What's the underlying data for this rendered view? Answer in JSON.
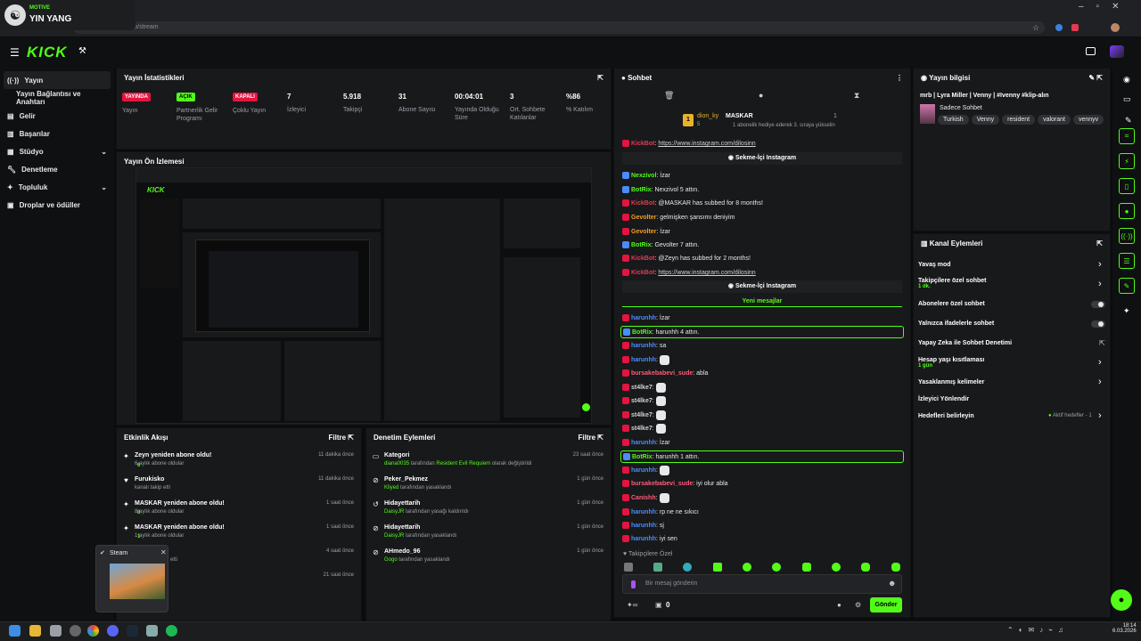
{
  "browser": {
    "url": "dashboard.kick.com/stream",
    "tab_plus": "+"
  },
  "media": {
    "app": "MOTIVE",
    "title": "YIN YANG"
  },
  "header": {
    "logo": "KICK"
  },
  "sidebar": {
    "items": [
      {
        "label": "Yayın",
        "icon": "broadcast-icon"
      },
      {
        "label": "Yayın Bağlantısı ve Anahtarı",
        "icon": ""
      },
      {
        "label": "Gelir",
        "icon": "revenue-icon"
      },
      {
        "label": "Başarılar",
        "icon": "trophy-icon"
      },
      {
        "label": "Stüdyo",
        "icon": "studio-icon"
      },
      {
        "label": "Denetleme",
        "icon": "wrench-icon"
      },
      {
        "label": "Topluluk",
        "icon": "community-icon"
      },
      {
        "label": "Droplar ve ödüller",
        "icon": "gift-icon"
      }
    ]
  },
  "stats": {
    "title": "Yayın İstatistikleri",
    "items": [
      {
        "badge": "YAYINDA",
        "label": "Yayın"
      },
      {
        "badge": "AÇIK",
        "label": "Partnerlik Gelir Programı"
      },
      {
        "badge": "KAPALI",
        "label": "Çoklu Yayın"
      },
      {
        "value": "7",
        "label": "İzleyici"
      },
      {
        "value": "5.918",
        "label": "Takipçi"
      },
      {
        "value": "31",
        "label": "Abone Sayısı"
      },
      {
        "value": "00:04:01",
        "label": "Yayında Olduğu Süre"
      },
      {
        "value": "3",
        "label": "Ort. Sohbete Katılanlar"
      },
      {
        "value": "%86",
        "label": "% Katılım"
      }
    ]
  },
  "preview": {
    "title": "Yayın Ön İzlemesi"
  },
  "activity": {
    "title": "Etkinlik Akışı",
    "filter": "Filtre",
    "rows": [
      {
        "t1": "Zeyn yeniden abone oldu!",
        "t2": "6 aylık abone oldular",
        "time": "11 dakika önce"
      },
      {
        "t1": "Furukisko",
        "t2": "kanalı takip etti",
        "time": "11 dakika önce"
      },
      {
        "t1": "MASKAR yeniden abone oldu!",
        "t2": "8 aylık abone oldular",
        "time": "1 saat önce"
      },
      {
        "t1": "MASKAR yeniden abone oldu!",
        "t2": "1 aylık abone oldular",
        "time": "1 saat önce"
      },
      {
        "t1": "",
        "t2": "etti",
        "time": "4 saat önce"
      },
      {
        "t1": "",
        "t2": "",
        "time": "21 saat önce"
      }
    ]
  },
  "moderation": {
    "title": "Denetim Eylemleri",
    "filter": "Filtre",
    "rows": [
      {
        "t1": "Kategori",
        "user": "diana0035",
        "mid": " tarafından ",
        "hl": "Resident Evil Requiem",
        "end": " olarak değiştirildi",
        "time": "23 saat önce"
      },
      {
        "t1": "Peker_Pekmez",
        "user": "Kliyed",
        "mid": " tarafından yasaklandı",
        "hl": "",
        "end": "",
        "time": "1 gün önce"
      },
      {
        "t1": "Hidayettarih",
        "user": "DaisyJR",
        "mid": " tarafından yasağı kaldırıldı",
        "hl": "",
        "end": "",
        "time": "1 gün önce"
      },
      {
        "t1": "Hidayettarih",
        "user": "DaisyJR",
        "mid": " tarafından yasaklandı",
        "hl": "",
        "end": "",
        "time": "1 gün önce"
      },
      {
        "t1": "AHmedo_96",
        "user": "Gogo",
        "mid": " tarafından yasaklandı",
        "hl": "",
        "end": "",
        "time": "1 gün önce"
      }
    ]
  },
  "steam_popup": {
    "title": "Steam"
  },
  "chat": {
    "title": "Sohbet",
    "pinned_user": "dion_ky",
    "pinned_count": "5",
    "pinned_name": "MASKAR",
    "pinned_num": "1",
    "pinned_note": "1 abonelik hediye ederek 3. sıraya yükselin",
    "lines": [
      {
        "user": "KickBot",
        "ucolor": "#e23b52",
        "text": "https://www.instagram.com/dilosinn",
        "link": true
      },
      {
        "center": "Sekme-İçi Instagram"
      },
      {
        "user": "Nexzivol",
        "ucolor": "#53fc18",
        "text": "İzar"
      },
      {
        "user": "BotRix",
        "ucolor": "#53fc18",
        "text": "Nexzivol 5 attın."
      },
      {
        "user": "KickBot",
        "ucolor": "#e23b52",
        "text": "@MASKAR has subbed for 8 months!"
      },
      {
        "user": "Gevolter",
        "ucolor": "#f0a020",
        "text": "gelmişken şansımı deniyim"
      },
      {
        "user": "Gevolter",
        "ucolor": "#f0a020",
        "text": "İzar"
      },
      {
        "user": "BotRix",
        "ucolor": "#53fc18",
        "text": "Gevolter 7 attın."
      },
      {
        "user": "KickBot",
        "ucolor": "#e23b52",
        "text": "@Zeyn has subbed for 2 months!"
      },
      {
        "user": "KickBot",
        "ucolor": "#e23b52",
        "text": "https://www.instagram.com/dilosinn",
        "link": true
      },
      {
        "center": "Sekme-İçi Instagram"
      },
      {
        "divider": "Yeni mesajlar"
      },
      {
        "user": "harunhh",
        "ucolor": "#4a8cff",
        "text": "İzar"
      },
      {
        "user": "BotRix",
        "ucolor": "#53fc18",
        "text": "harunhh 4 attın.",
        "box": true
      },
      {
        "user": "harunhh",
        "ucolor": "#4a8cff",
        "text": "sa"
      },
      {
        "user": "harunhh",
        "ucolor": "#4a8cff",
        "text": "",
        "emote": true
      },
      {
        "user": "bursakebabevi_sude",
        "ucolor": "#ff5a7a",
        "text": "abla"
      },
      {
        "user": "st4lke7",
        "ucolor": "#cfd3d7",
        "text": "",
        "emote": true
      },
      {
        "user": "st4lke7",
        "ucolor": "#cfd3d7",
        "text": "",
        "emote": true
      },
      {
        "user": "st4lke7",
        "ucolor": "#cfd3d7",
        "text": "",
        "emote": true
      },
      {
        "user": "st4lke7",
        "ucolor": "#cfd3d7",
        "text": "",
        "emote": true
      },
      {
        "user": "harunhh",
        "ucolor": "#4a8cff",
        "text": "İzar"
      },
      {
        "user": "BotRix",
        "ucolor": "#53fc18",
        "text": "harunhh 1 attın.",
        "box": true
      },
      {
        "user": "harunhh",
        "ucolor": "#4a8cff",
        "text": "",
        "emote": true
      },
      {
        "user": "bursakebabevi_sude",
        "ucolor": "#ff5a7a",
        "text": "iyi olur abla"
      },
      {
        "user": "Canishh",
        "ucolor": "#ff5a7a",
        "text": "",
        "emote": true
      },
      {
        "user": "harunhh",
        "ucolor": "#4a8cff",
        "text": "rp ne ne sıkıcı"
      },
      {
        "user": "harunhh",
        "ucolor": "#4a8cff",
        "text": "sj"
      },
      {
        "user": "harunhh",
        "ucolor": "#4a8cff",
        "text": "iyi sen"
      }
    ],
    "followers_only": "Takipçilere Özel",
    "input_placeholder": "Bir mesaj gönderin",
    "send": "Gönder",
    "footer_count": "0"
  },
  "stream_info": {
    "title": "Yayın bilgisi",
    "stream_title": "mrb | Lyra Miller | Venny | #Ivenny #klip-alın",
    "mode": "Sadece Sohbet",
    "tags": [
      "Turkish",
      "Venny",
      "resident",
      "valorant",
      "vennyv"
    ]
  },
  "channel_actions": {
    "title": "Kanal Eylemleri",
    "rows": [
      {
        "label": "Yavaş mod",
        "sub": "",
        "kind": "arrow"
      },
      {
        "label": "Takipçilere özel sohbet",
        "sub": "1 dk.",
        "kind": "arrow"
      },
      {
        "label": "Abonelere özel sohbet",
        "sub": "",
        "kind": "toggle"
      },
      {
        "label": "Yalnızca ifadelerle sohbet",
        "sub": "",
        "kind": "toggle"
      },
      {
        "label": "Yapay Zeka ile Sohbet Denetimi",
        "sub": "",
        "kind": "ext"
      },
      {
        "label": "Hesap yaşı kısıtlaması",
        "sub": "1 gün",
        "kind": "arrow"
      },
      {
        "label": "Yasaklanmış kelimeler",
        "sub": "",
        "kind": "arrow"
      },
      {
        "label": "İzleyici Yönlendir",
        "sub": "",
        "kind": "none"
      },
      {
        "label": "Hedefleri belirleyin",
        "sub": "",
        "kind": "arrow",
        "extra": "Aktif hedefler - 1"
      }
    ]
  },
  "clock": {
    "time": "18:14",
    "date": "6.03.2026"
  },
  "colors": {
    "accent": "#53fc18",
    "live": "#e5133f",
    "bg": "#0b0c0d",
    "panel": "#18191b"
  }
}
